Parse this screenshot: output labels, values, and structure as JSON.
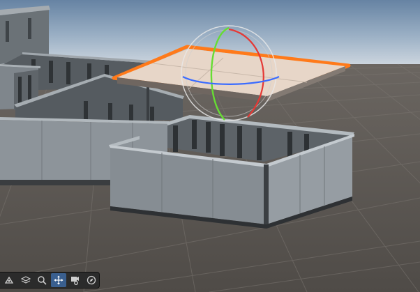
{
  "viewport": {
    "colors": {
      "sky_top": "#5f7fa0",
      "horizon": "#c9d2dc",
      "floor": "#57534f",
      "grid": "#6d6965",
      "wall_outer": "#8d949a",
      "wall_inner": "#5b6166",
      "wall_top": "#9fa6ac",
      "selection_outline": "#ff7a1a",
      "gizmo_x": "#e53935",
      "gizmo_y": "#66dd33",
      "gizmo_z": "#3b6cff",
      "gizmo_sphere": "#e6e6e6"
    },
    "selected_object": "floor-slab-panel"
  },
  "toolbar": {
    "tools": [
      {
        "id": "orbit",
        "icon": "orbit-icon",
        "active": false
      },
      {
        "id": "layers",
        "icon": "layers-icon",
        "active": false
      },
      {
        "id": "zoom",
        "icon": "magnifier-icon",
        "active": false
      },
      {
        "id": "move",
        "icon": "move-arrows-icon",
        "active": true
      },
      {
        "id": "camera",
        "icon": "camera-icon",
        "active": false
      },
      {
        "id": "compass",
        "icon": "compass-icon",
        "active": false
      }
    ]
  }
}
